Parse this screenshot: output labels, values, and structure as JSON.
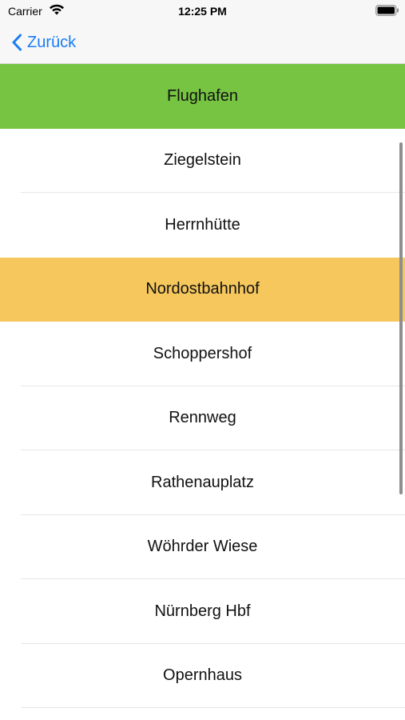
{
  "status_bar": {
    "carrier": "Carrier",
    "time": "12:25 PM",
    "icons": [
      "wifi-icon",
      "battery-icon"
    ]
  },
  "nav": {
    "back_label": "Zurück",
    "back_icon": "chevron-left-icon",
    "accent_color": "#1a7cf5"
  },
  "colors": {
    "green": "#76c442",
    "yellow": "#f5c75c"
  },
  "stops": [
    {
      "label": "Flughafen",
      "highlight": "green"
    },
    {
      "label": "Ziegelstein",
      "highlight": ""
    },
    {
      "label": "Herrnhütte",
      "highlight": ""
    },
    {
      "label": "Nordostbahnhof",
      "highlight": "yellow"
    },
    {
      "label": "Schoppershof",
      "highlight": ""
    },
    {
      "label": "Rennweg",
      "highlight": ""
    },
    {
      "label": "Rathenauplatz",
      "highlight": ""
    },
    {
      "label": "Wöhrder Wiese",
      "highlight": ""
    },
    {
      "label": "Nürnberg Hbf",
      "highlight": ""
    },
    {
      "label": "Opernhaus",
      "highlight": ""
    }
  ]
}
